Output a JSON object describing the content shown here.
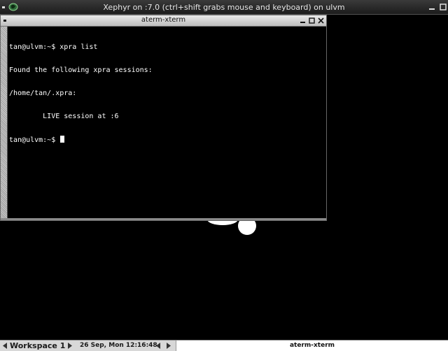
{
  "xephyr": {
    "title": "Xephyr on :7.0 (ctrl+shift grabs mouse and keyboard) on ulvm",
    "icon": "xephyr-app-icon"
  },
  "aterm": {
    "title": "aterm-xterm",
    "lines": [
      "tan@ulvm:~$ xpra list",
      "Found the following xpra sessions:",
      "/home/tan/.xpra:",
      "        LIVE session at :6",
      "tan@ulvm:~$ "
    ]
  },
  "taskbar": {
    "workspace": "Workspace 1",
    "clock": "26 Sep, Mon 12:16:48",
    "task": "aterm-xterm"
  },
  "colors": {
    "desktop": "#000000",
    "terminal_bg": "#000000",
    "terminal_fg": "#ffffff",
    "titlebar_active": "#d0d0d0",
    "taskbar": "#d8d8d8"
  }
}
